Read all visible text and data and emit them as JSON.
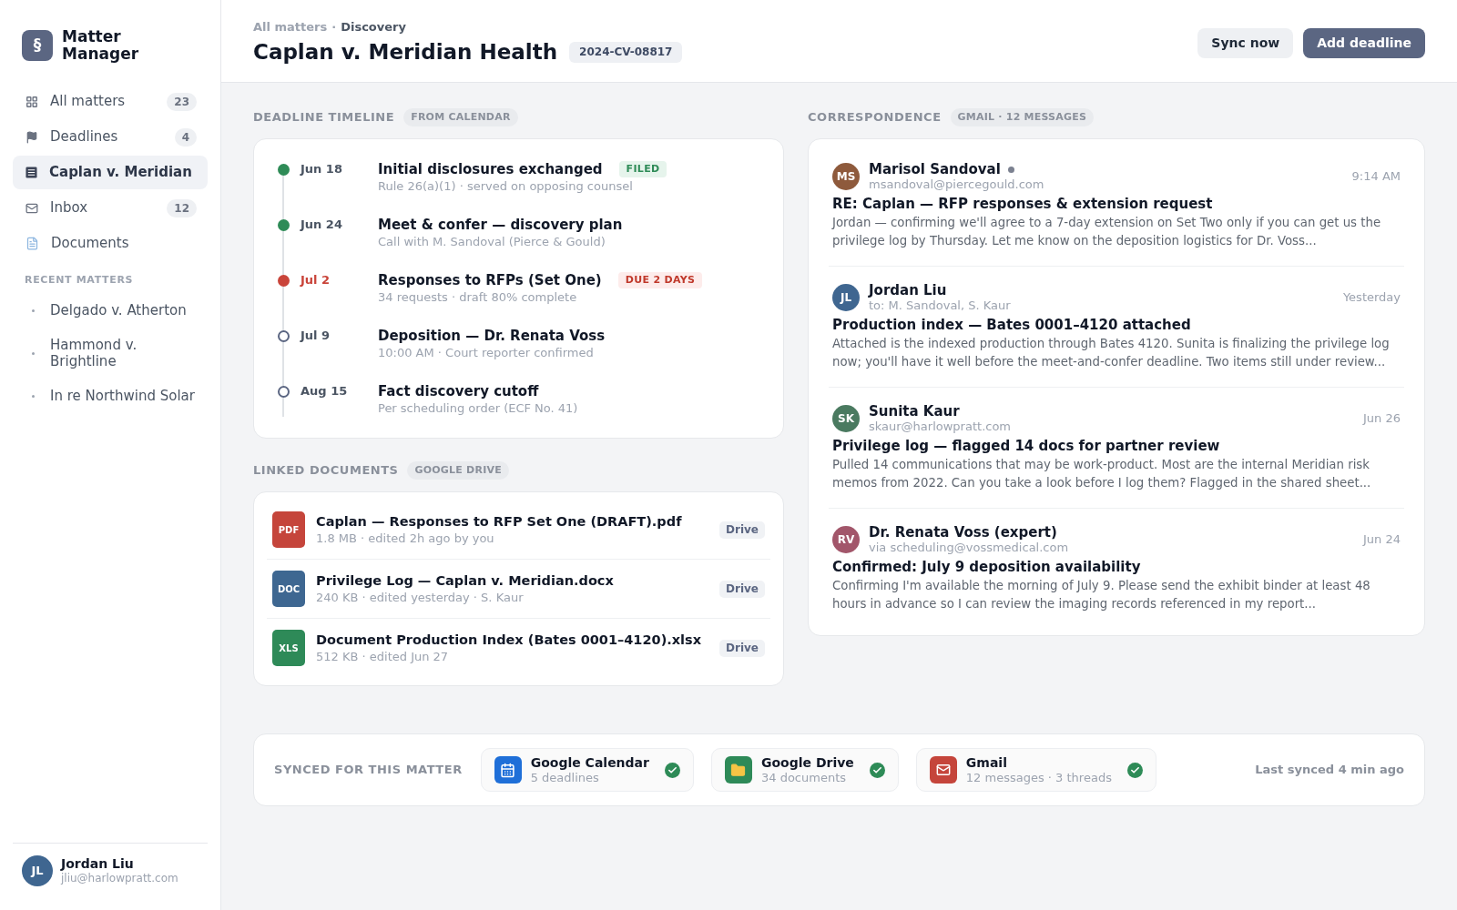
{
  "sidebar": {
    "logo": {
      "mark": "§",
      "name": "Matter Manager"
    },
    "nav": [
      {
        "label": "All matters",
        "count": "23",
        "selected": false
      },
      {
        "label": "Deadlines",
        "count": "4",
        "selected": false
      },
      {
        "label": "Caplan v. Meridian",
        "selected": true
      },
      {
        "label": "Inbox",
        "count": "12",
        "selected": false
      },
      {
        "label": "Documents",
        "selected": false
      }
    ],
    "recent_heading": "RECENT MATTERS",
    "recent_matters": [
      "Delgado v. Atherton",
      "Hammond v. Brightline",
      "In re Northwind Solar"
    ],
    "user": {
      "initials": "JL",
      "color": "#3f6690",
      "name": "Jordan Liu",
      "email": "jliu@harlowpratt.com"
    }
  },
  "header": {
    "breadcrumb": [
      {
        "label": "All matters",
        "current": false
      },
      {
        "label": "Discovery",
        "current": true
      }
    ],
    "breadcrumb_separator": "·",
    "title": "Caplan v. Meridian Health",
    "case_number": "2024-CV-08817",
    "buttons": [
      {
        "label": "Sync now",
        "kind": "secondary"
      },
      {
        "label": "Add deadline",
        "kind": "primary"
      }
    ]
  },
  "timeline": {
    "heading": "DEADLINE TIMELINE",
    "tag": "FROM CALENDAR",
    "items": [
      {
        "date": "Jun 18",
        "title": "Initial disclosures exchanged",
        "detail": "Rule 26(a)(1) · served on opposing counsel",
        "completed": true,
        "urgent": false,
        "badge": {
          "label": "FILED",
          "kind": "success"
        }
      },
      {
        "date": "Jun 24",
        "title": "Meet & confer — discovery plan",
        "detail": "Call with M. Sandoval (Pierce & Gould)",
        "completed": true,
        "urgent": false
      },
      {
        "date": "Jul 2",
        "title": "Responses to RFPs (Set One)",
        "detail": "34 requests · draft 80% complete",
        "completed": false,
        "urgent": true,
        "badge": {
          "label": "DUE 2 DAYS",
          "kind": "danger"
        }
      },
      {
        "date": "Jul 9",
        "title": "Deposition — Dr. Renata Voss",
        "detail": "10:00 AM · Court reporter confirmed",
        "completed": false,
        "urgent": false
      },
      {
        "date": "Aug 15",
        "title": "Fact discovery cutoff",
        "detail": "Per scheduling order (ECF No. 41)",
        "completed": false,
        "urgent": false
      }
    ]
  },
  "documents": {
    "heading": "LINKED DOCUMENTS",
    "tag": "GOOGLE DRIVE",
    "items": [
      {
        "type": "PDF",
        "color": "#c5453b",
        "name": "Caplan — Responses to RFP Set One (DRAFT).pdf",
        "meta": "1.8 MB · edited 2h ago by you",
        "source": "Drive"
      },
      {
        "type": "DOC",
        "color": "#3e6791",
        "name": "Privilege Log — Caplan v. Meridian.docx",
        "meta": "240 KB · edited yesterday · S. Kaur",
        "source": "Drive"
      },
      {
        "type": "XLS",
        "color": "#2e8a58",
        "name": "Document Production Index (Bates 0001–4120).xlsx",
        "meta": "512 KB · edited Jun 27",
        "source": "Drive"
      }
    ]
  },
  "correspondence": {
    "heading": "CORRESPONDENCE",
    "tag": "GMAIL · 12 MESSAGES",
    "messages": [
      {
        "initials": "MS",
        "color": "#8e5a3c",
        "sender": "Marisol Sandoval",
        "unread": true,
        "address": "msandoval@piercegould.com",
        "time": "9:14 AM",
        "subject": "RE: Caplan — RFP responses & extension request",
        "preview": "Jordan — confirming we'll agree to a 7-day extension on Set Two only if you can get us the privilege log by Thursday. Let me know on the deposition logistics for Dr. Voss..."
      },
      {
        "initials": "JL",
        "color": "#3f6690",
        "sender": "Jordan Liu",
        "unread": false,
        "address": "to: M. Sandoval, S. Kaur",
        "time": "Yesterday",
        "subject": "Production index — Bates 0001–4120 attached",
        "preview": "Attached is the indexed production through Bates 4120. Sunita is finalizing the privilege log now; you'll have it well before the meet-and-confer deadline. Two items still under review..."
      },
      {
        "initials": "SK",
        "color": "#4a7a60",
        "sender": "Sunita Kaur",
        "unread": false,
        "address": "skaur@harlowpratt.com",
        "time": "Jun 26",
        "subject": "Privilege log — flagged 14 docs for partner review",
        "preview": "Pulled 14 communications that may be work-product. Most are the internal Meridian risk memos from 2022. Can you take a look before I log them? Flagged in the shared sheet..."
      },
      {
        "initials": "RV",
        "color": "#a2566a",
        "sender": "Dr. Renata Voss (expert)",
        "unread": false,
        "address": "via scheduling@vossmedical.com",
        "time": "Jun 24",
        "subject": "Confirmed: July 9 deposition availability",
        "preview": "Confirming I'm available the morning of July 9. Please send the exhibit binder at least 48 hours in advance so I can review the imaging records referenced in my report..."
      }
    ]
  },
  "sync": {
    "label": "SYNCED FOR THIS MATTER",
    "services": [
      {
        "name": "Google Calendar",
        "detail": "5 deadlines",
        "color": "#1f6fd8",
        "synced": true
      },
      {
        "name": "Google Drive",
        "detail": "34 documents",
        "color": "#2e8a58",
        "synced": true
      },
      {
        "name": "Gmail",
        "detail": "12 messages · 3 threads",
        "color": "#c5453b",
        "synced": true
      }
    ],
    "last_synced": "Last synced 4 min ago"
  }
}
